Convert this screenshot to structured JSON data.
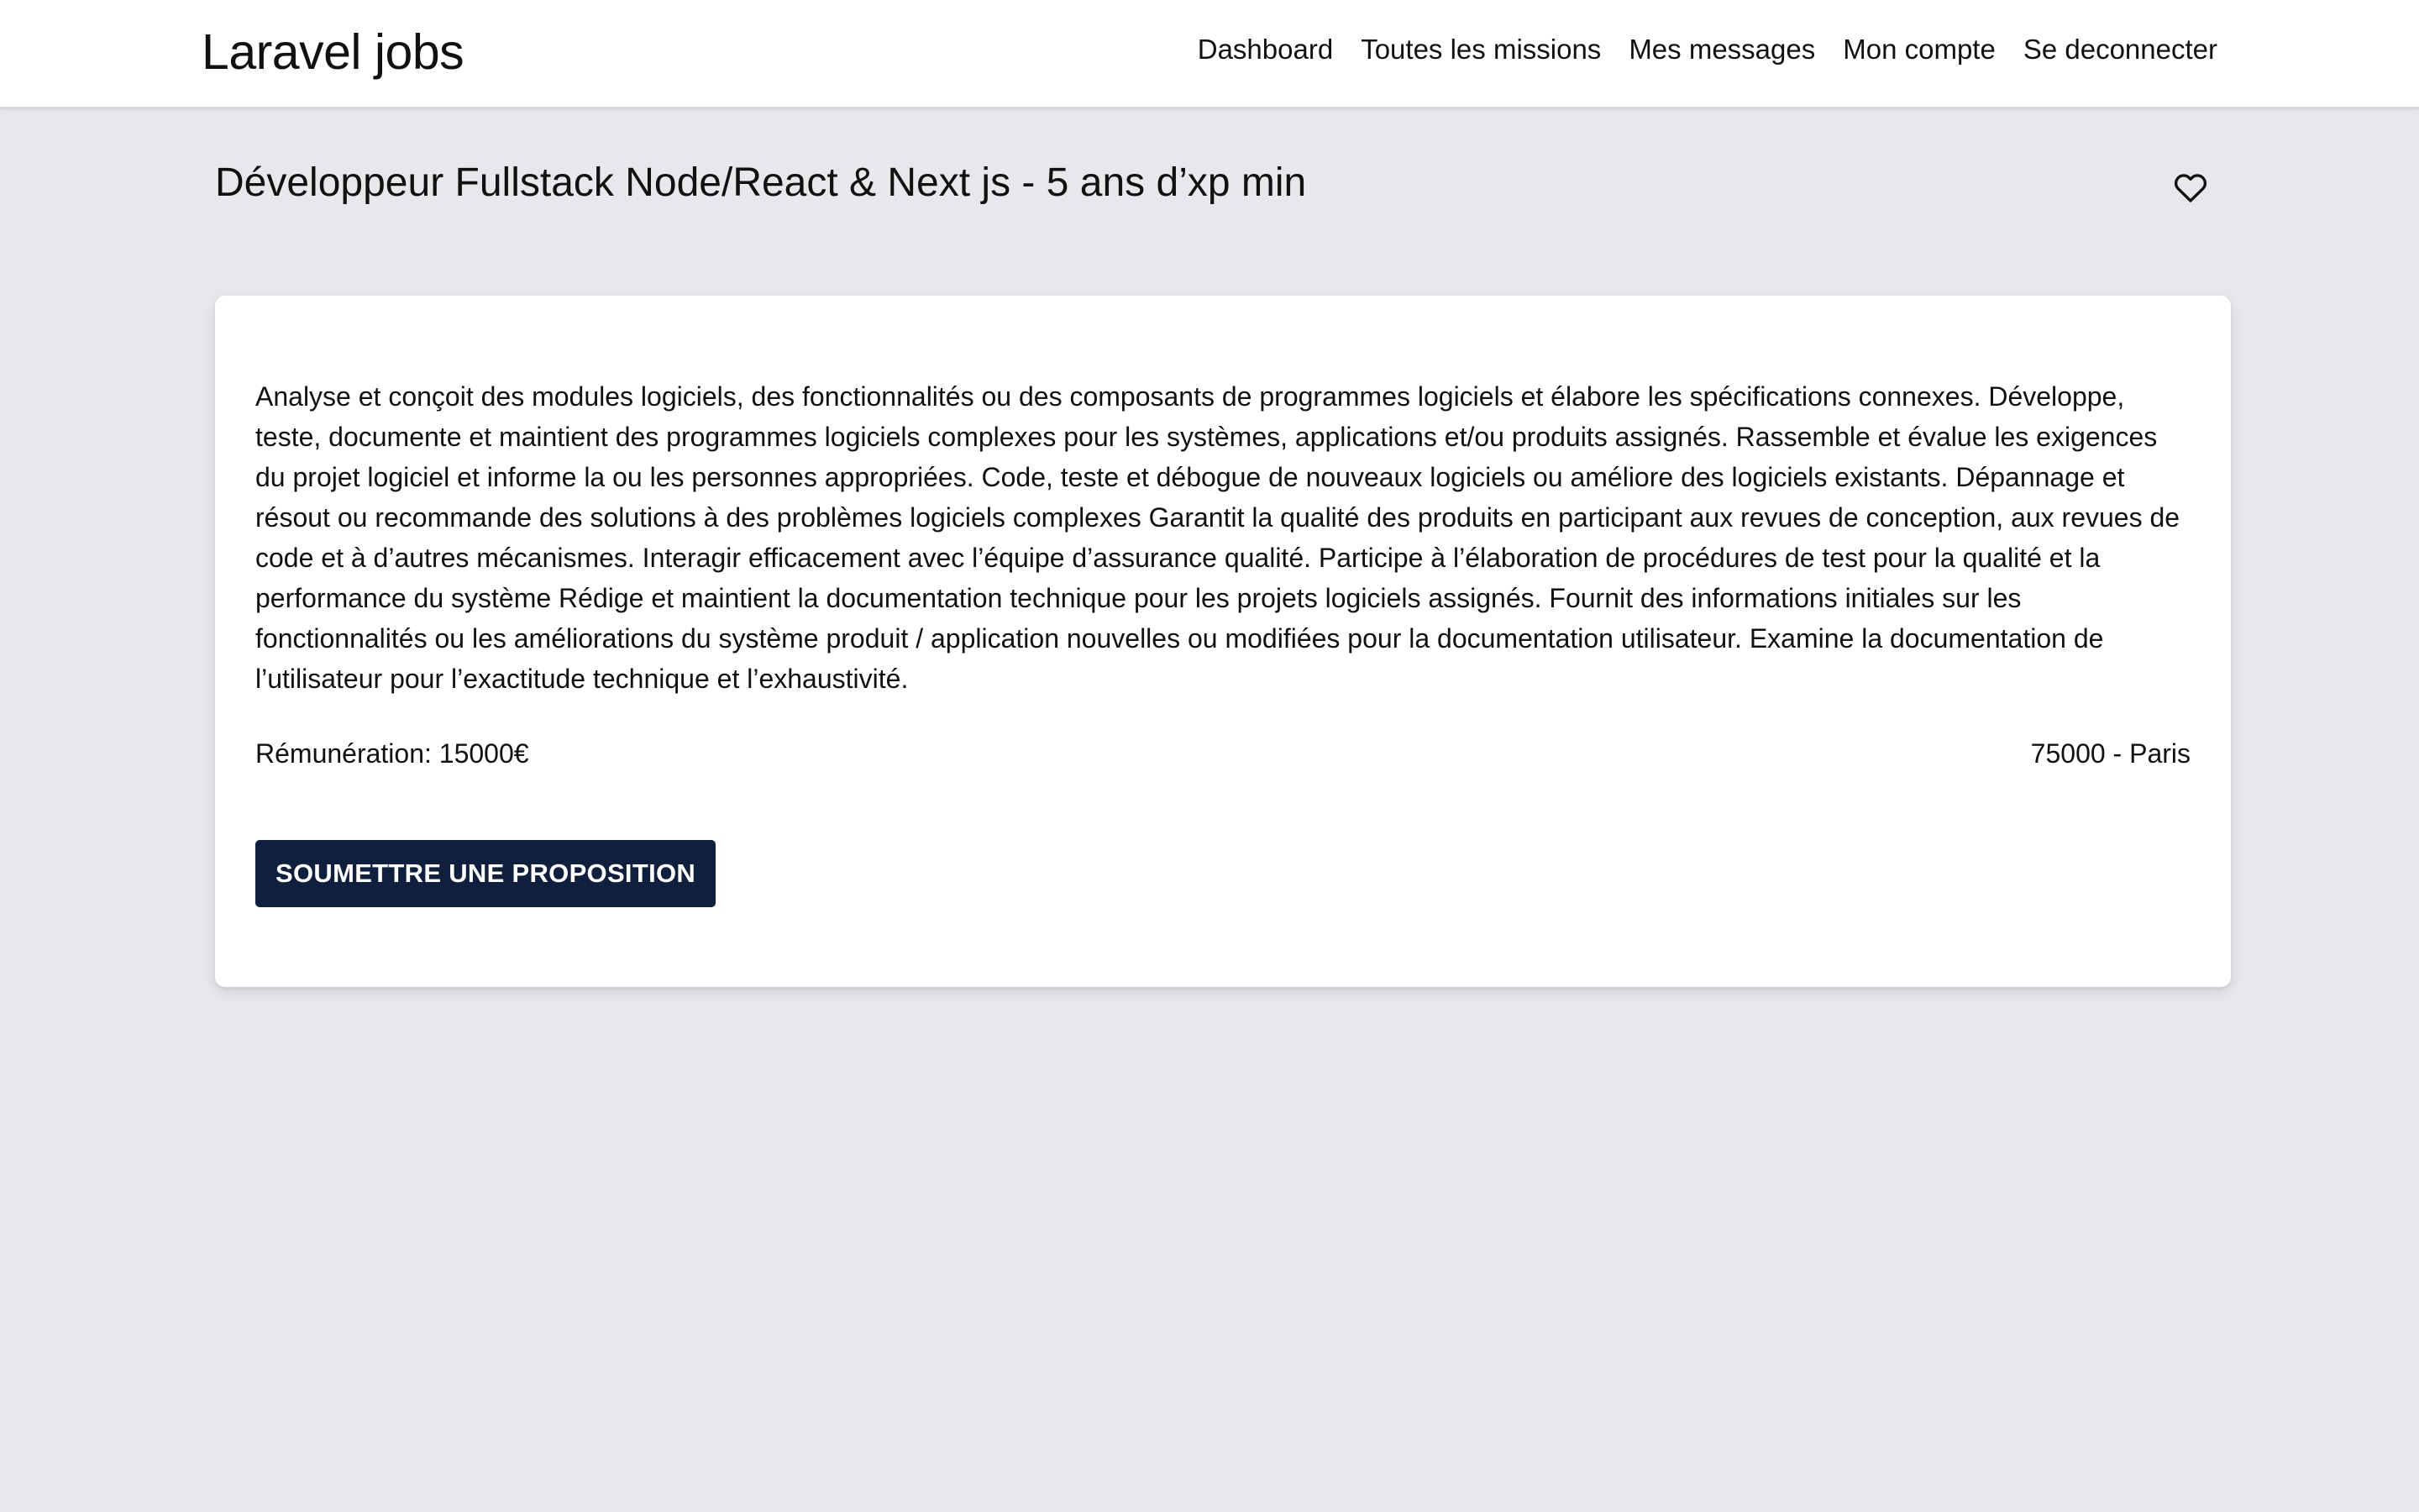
{
  "header": {
    "brand": "Laravel jobs",
    "nav": [
      {
        "label": "Dashboard"
      },
      {
        "label": "Toutes les missions"
      },
      {
        "label": "Mes messages"
      },
      {
        "label": "Mon compte"
      },
      {
        "label": "Se deconnecter"
      }
    ]
  },
  "mission": {
    "title": "Développeur Fullstack Node/React & Next js - 5 ans d’xp min",
    "favorite_icon": "heart-outline-icon",
    "description": "Analyse et conçoit des modules logiciels, des fonctionnalités ou des composants de programmes logiciels et élabore les spécifications connexes. Développe, teste, documente et maintient des programmes logiciels complexes pour les systèmes, applications et/ou produits assignés. Rassemble et évalue les exigences du projet logiciel et informe la ou les personnes appropriées. Code, teste et débogue de nouveaux logiciels ou améliore des logiciels existants. Dépannage et résout ou recommande des solutions à des problèmes logiciels complexes Garantit la qualité des produits en participant aux revues de conception, aux revues de code et à d’autres mécanismes. Interagir efficacement avec l’équipe d’assurance qualité. Participe à l’élaboration de procédures de test pour la qualité et la performance du système Rédige et maintient la documentation technique pour les projets logiciels assignés. Fournit des informations initiales sur les fonctionnalités ou les améliorations du système produit / application nouvelles ou modifiées pour la documentation utilisateur. Examine la documentation de l’utilisateur pour l’exactitude technique et l’exhaustivité.",
    "salary": "Rémunération: 15000€",
    "location": "75000 - Paris",
    "submit_label": "SOUMETTRE UNE PROPOSITION"
  },
  "colors": {
    "page_background": "#e6e8ec",
    "button_background": "#0f1f3d",
    "button_text": "#ffffff"
  }
}
